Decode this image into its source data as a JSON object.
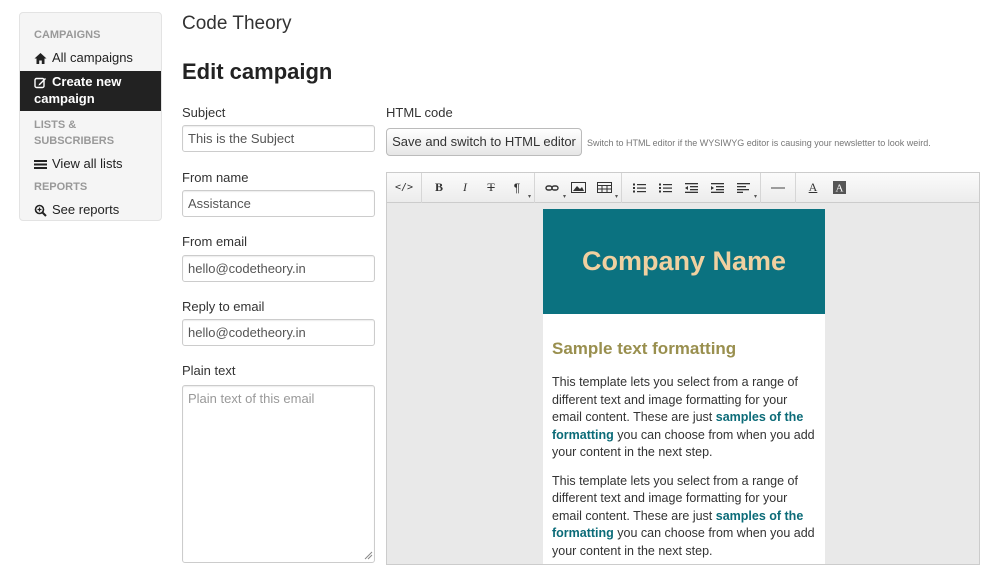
{
  "sidebar": {
    "campaigns_header": "CAMPAIGNS",
    "all_campaigns": "All campaigns",
    "create_new_line1": "Create new",
    "create_new_line2": "campaign",
    "lists_header_line1": "LISTS &",
    "lists_header_line2": "SUBSCRIBERS",
    "view_all_lists": "View all lists",
    "reports_header": "REPORTS",
    "see_reports": "See reports"
  },
  "header": {
    "brand": "Code Theory",
    "title": "Edit campaign"
  },
  "form": {
    "subject_label": "Subject",
    "subject_value": "This is the Subject",
    "from_name_label": "From name",
    "from_name_value": "Assistance",
    "from_email_label": "From email",
    "from_email_value": "hello@codetheory.in",
    "reply_to_label": "Reply to email",
    "reply_to_value": "hello@codetheory.in",
    "plain_text_label": "Plain text",
    "plain_text_placeholder": "Plain text of this email"
  },
  "html_code": {
    "label": "HTML code",
    "switch_button": "Save and switch to HTML editor",
    "hint": "Switch to HTML editor if the WYSIWYG editor is causing your newsletter to look weird."
  },
  "toolbar": {
    "source_label": "</>",
    "bold_label": "B",
    "italic_label": "I",
    "strike_label": "T",
    "paragraph_label": "¶",
    "color_label": "A"
  },
  "email_preview": {
    "company_name": "Company Name",
    "heading": "Sample text formatting",
    "para_start": "This template lets you select from a range of different text and image formatting for your email content. These are just ",
    "para_bold": "samples of the formatting",
    "para_end": " you can choose from when you add your content in the next step.",
    "header_bg": "#0b7280",
    "company_color": "#f0d0a0",
    "heading_color": "#998f4e"
  }
}
